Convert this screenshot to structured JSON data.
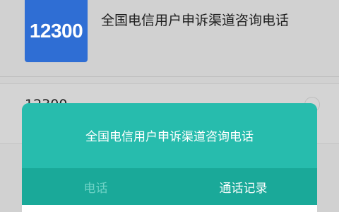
{
  "app": {
    "logo_text": "12300",
    "title": "全国电信用户申诉渠道咨询电话"
  },
  "field": {
    "value": "12300"
  },
  "dialog": {
    "title": "全国电信用户申诉渠道咨询电话",
    "tabs": [
      {
        "label": "电话",
        "state": "inactive"
      },
      {
        "label": "通话记录",
        "state": "active"
      }
    ]
  },
  "colors": {
    "accent": "#27bcad",
    "logo_bg": "#2f6ed4"
  }
}
